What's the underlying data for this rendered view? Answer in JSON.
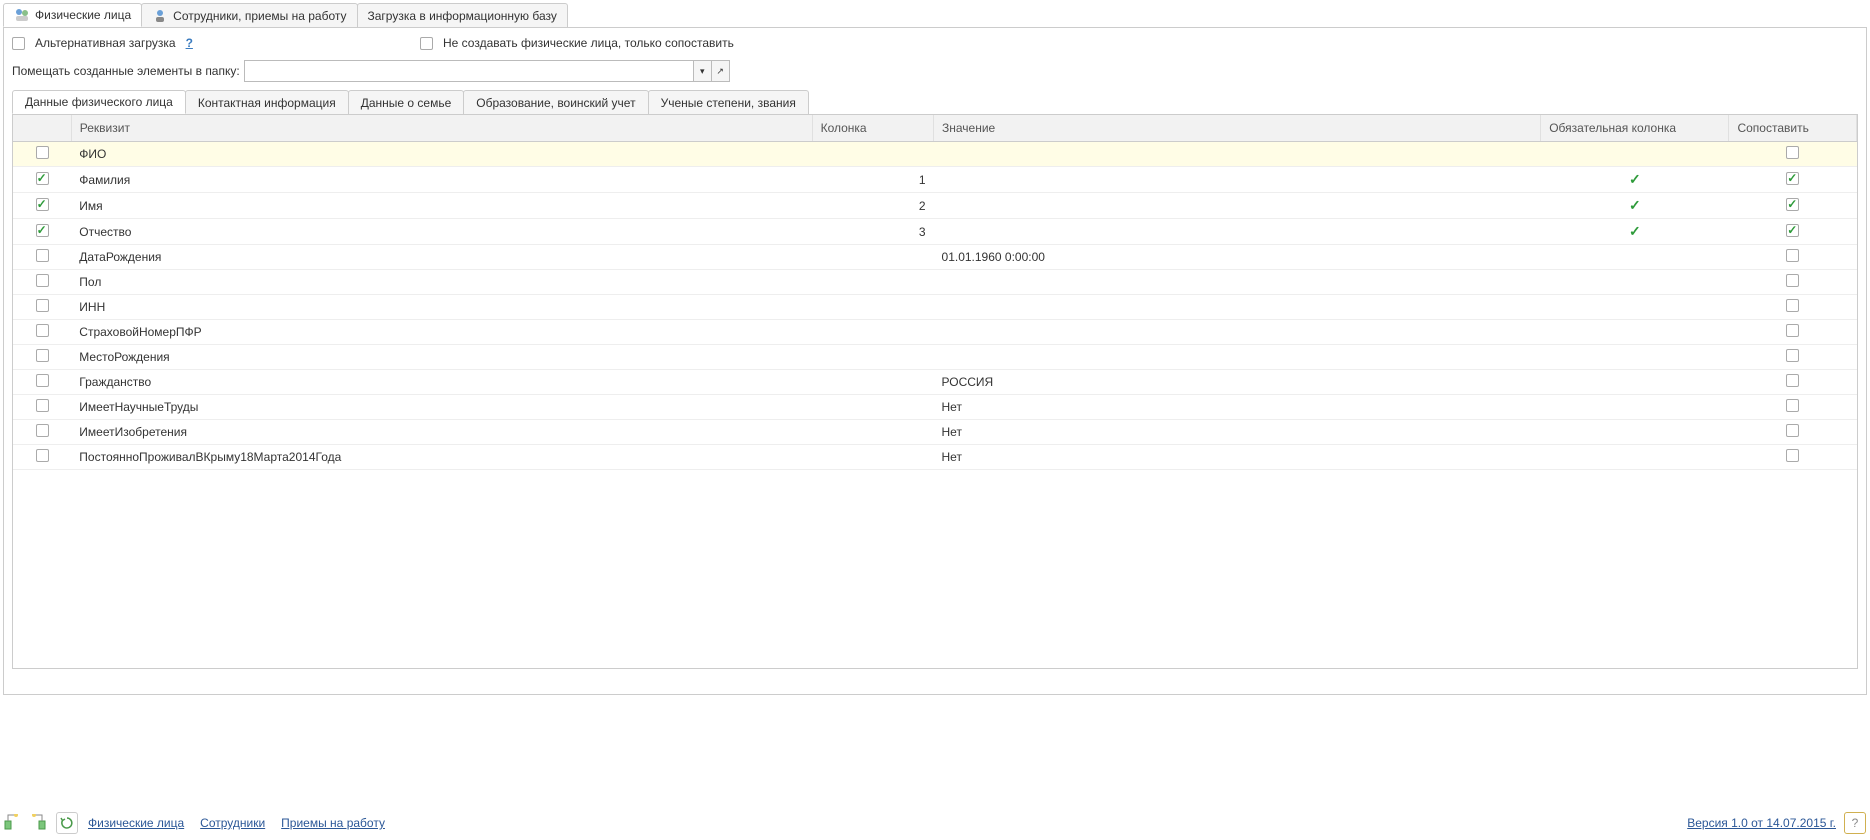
{
  "top_tabs": [
    {
      "label": "Физические лица",
      "active": true,
      "icon": "people"
    },
    {
      "label": "Сотрудники, приемы на работу",
      "active": false,
      "icon": "person"
    },
    {
      "label": "Загрузка в информационную базу",
      "active": false,
      "icon": ""
    }
  ],
  "options": {
    "alt_load_checked": false,
    "alt_load_label": "Альтернативная загрузка",
    "help_symbol": "?",
    "no_create_checked": false,
    "no_create_label": "Не создавать физические лица, только сопоставить"
  },
  "folder": {
    "label": "Помещать созданные элементы в папку:",
    "value": "",
    "dropdown_glyph": "▾",
    "open_glyph": "↗"
  },
  "inner_tabs": [
    {
      "label": "Данные физического лица",
      "active": true
    },
    {
      "label": "Контактная информация",
      "active": false
    },
    {
      "label": "Данные о семье",
      "active": false
    },
    {
      "label": "Образование, воинский учет",
      "active": false
    },
    {
      "label": "Ученые степени, звания",
      "active": false
    }
  ],
  "columns": {
    "check": "",
    "requisite": "Реквизит",
    "column": "Колонка",
    "value": "Значение",
    "mandatory": "Обязательная колонка",
    "match": "Сопоставить"
  },
  "rows": [
    {
      "checked": false,
      "req": "ФИО",
      "col": "",
      "val": "",
      "mandatory": false,
      "match_checked": false,
      "highlight": true
    },
    {
      "checked": true,
      "req": "Фамилия",
      "col": "1",
      "val": "",
      "mandatory": true,
      "match_checked": true,
      "highlight": false
    },
    {
      "checked": true,
      "req": "Имя",
      "col": "2",
      "val": "",
      "mandatory": true,
      "match_checked": true,
      "highlight": false
    },
    {
      "checked": true,
      "req": "Отчество",
      "col": "3",
      "val": "",
      "mandatory": true,
      "match_checked": true,
      "highlight": false
    },
    {
      "checked": false,
      "req": "ДатаРождения",
      "col": "",
      "val": "01.01.1960 0:00:00",
      "mandatory": false,
      "match_checked": false,
      "highlight": false
    },
    {
      "checked": false,
      "req": "Пол",
      "col": "",
      "val": "",
      "mandatory": false,
      "match_checked": false,
      "highlight": false
    },
    {
      "checked": false,
      "req": "ИНН",
      "col": "",
      "val": "",
      "mandatory": false,
      "match_checked": false,
      "highlight": false
    },
    {
      "checked": false,
      "req": "СтраховойНомерПФР",
      "col": "",
      "val": "",
      "mandatory": false,
      "match_checked": false,
      "highlight": false
    },
    {
      "checked": false,
      "req": "МестоРождения",
      "col": "",
      "val": "",
      "mandatory": false,
      "match_checked": false,
      "highlight": false
    },
    {
      "checked": false,
      "req": "Гражданство",
      "col": "",
      "val": "РОССИЯ",
      "mandatory": false,
      "match_checked": false,
      "highlight": false
    },
    {
      "checked": false,
      "req": "ИмеетНаучныеТруды",
      "col": "",
      "val": "Нет",
      "mandatory": false,
      "match_checked": false,
      "highlight": false
    },
    {
      "checked": false,
      "req": "ИмеетИзобретения",
      "col": "",
      "val": "Нет",
      "mandatory": false,
      "match_checked": false,
      "highlight": false
    },
    {
      "checked": false,
      "req": "ПостоянноПроживалВКрыму18Марта2014Года",
      "col": "",
      "val": "Нет",
      "mandatory": false,
      "match_checked": false,
      "highlight": false
    }
  ],
  "bottom": {
    "links": [
      "Физические лица",
      "Сотрудники",
      "Приемы на работу"
    ],
    "version": "Версия 1.0 от 14.07.2015 г.",
    "help": "?"
  }
}
